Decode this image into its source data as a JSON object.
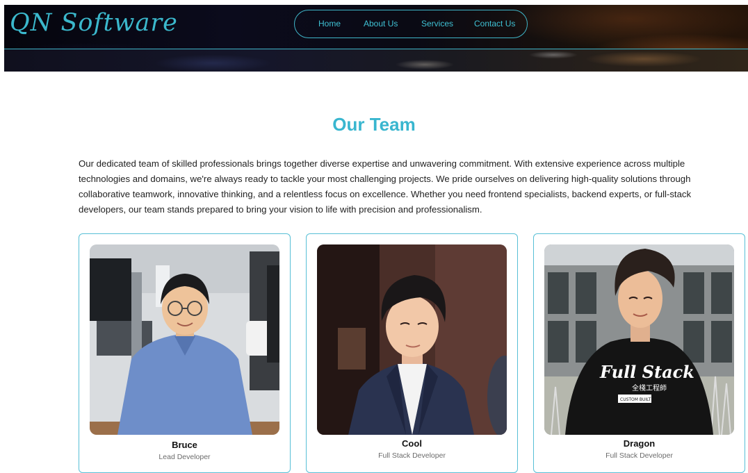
{
  "header": {
    "logo": "QN Software",
    "nav": [
      {
        "label": "Home"
      },
      {
        "label": "About Us"
      },
      {
        "label": "Services"
      },
      {
        "label": "Contact Us"
      }
    ]
  },
  "team": {
    "title": "Our Team",
    "intro": "Our dedicated team of skilled professionals brings together diverse expertise and unwavering commitment. With extensive experience across multiple technologies and domains, we're always ready to tackle your most challenging projects. We pride ourselves on delivering high-quality solutions through collaborative teamwork, innovative thinking, and a relentless focus on excellence. Whether you need frontend specialists, backend experts, or full-stack developers, our team stands prepared to bring your vision to life with precision and professionalism.",
    "members": [
      {
        "name": "Bruce",
        "role": "Lead Developer"
      },
      {
        "name": "Cool",
        "role": "Full Stack Developer"
      },
      {
        "name": "Dragon",
        "role": "Full Stack Developer",
        "shirt_text": "Full Stack 全棧工程師 CUSTOM BUILT"
      }
    ]
  },
  "colors": {
    "accent": "#39b6cf",
    "header_bg": "#0b0b1c",
    "card_border": "#57bfd6"
  }
}
